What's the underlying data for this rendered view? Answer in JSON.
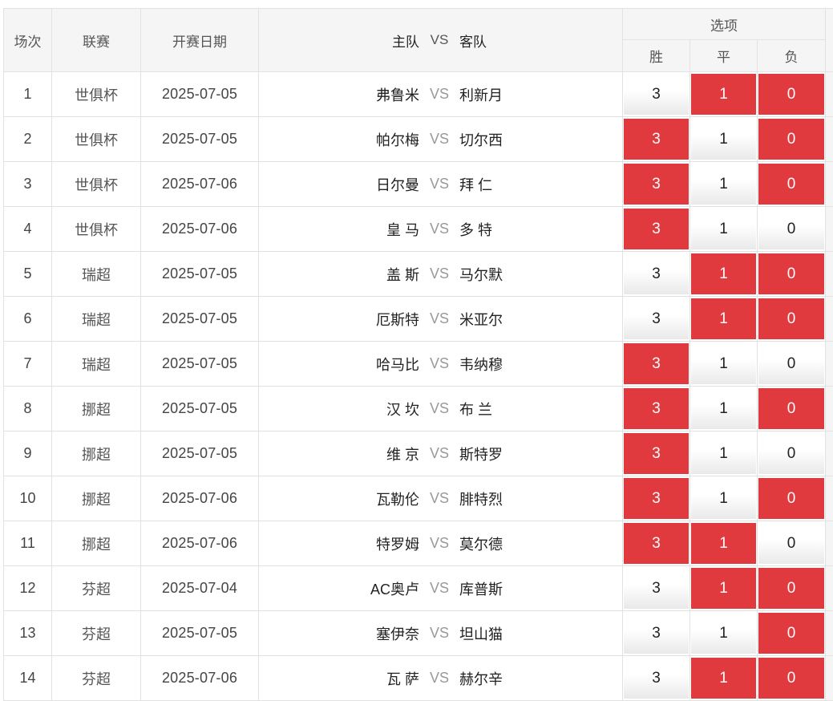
{
  "header": {
    "col_no": "场次",
    "col_league": "联赛",
    "col_date": "开赛日期",
    "col_match_home": "主队",
    "col_match_vs": "VS",
    "col_match_away": "客队",
    "col_options": "选项",
    "opt_win": "胜",
    "opt_draw": "平",
    "opt_lose": "负"
  },
  "colors": {
    "selected": "#e03a3e",
    "header_bg": "#f5f5f5"
  },
  "rows": [
    {
      "no": "1",
      "league": "世俱杯",
      "date": "2025-07-05",
      "home": "弗鲁米",
      "vs": "VS",
      "away": "利新月",
      "o3": "3",
      "o1": "1",
      "o0": "0",
      "sel": [
        false,
        true,
        true
      ]
    },
    {
      "no": "2",
      "league": "世俱杯",
      "date": "2025-07-05",
      "home": "帕尔梅",
      "vs": "VS",
      "away": "切尔西",
      "o3": "3",
      "o1": "1",
      "o0": "0",
      "sel": [
        true,
        false,
        true
      ]
    },
    {
      "no": "3",
      "league": "世俱杯",
      "date": "2025-07-06",
      "home": "日尔曼",
      "vs": "VS",
      "away": "拜 仁",
      "o3": "3",
      "o1": "1",
      "o0": "0",
      "sel": [
        true,
        false,
        true
      ]
    },
    {
      "no": "4",
      "league": "世俱杯",
      "date": "2025-07-06",
      "home": "皇 马",
      "vs": "VS",
      "away": "多 特",
      "o3": "3",
      "o1": "1",
      "o0": "0",
      "sel": [
        true,
        false,
        false
      ]
    },
    {
      "no": "5",
      "league": "瑞超",
      "date": "2025-07-05",
      "home": "盖 斯",
      "vs": "VS",
      "away": "马尔默",
      "o3": "3",
      "o1": "1",
      "o0": "0",
      "sel": [
        false,
        true,
        true
      ]
    },
    {
      "no": "6",
      "league": "瑞超",
      "date": "2025-07-05",
      "home": "厄斯特",
      "vs": "VS",
      "away": "米亚尔",
      "o3": "3",
      "o1": "1",
      "o0": "0",
      "sel": [
        false,
        true,
        true
      ]
    },
    {
      "no": "7",
      "league": "瑞超",
      "date": "2025-07-05",
      "home": "哈马比",
      "vs": "VS",
      "away": "韦纳穆",
      "o3": "3",
      "o1": "1",
      "o0": "0",
      "sel": [
        true,
        false,
        false
      ]
    },
    {
      "no": "8",
      "league": "挪超",
      "date": "2025-07-05",
      "home": "汉 坎",
      "vs": "VS",
      "away": "布 兰",
      "o3": "3",
      "o1": "1",
      "o0": "0",
      "sel": [
        true,
        false,
        true
      ]
    },
    {
      "no": "9",
      "league": "挪超",
      "date": "2025-07-05",
      "home": "维 京",
      "vs": "VS",
      "away": "斯特罗",
      "o3": "3",
      "o1": "1",
      "o0": "0",
      "sel": [
        true,
        false,
        false
      ]
    },
    {
      "no": "10",
      "league": "挪超",
      "date": "2025-07-06",
      "home": "瓦勒伦",
      "vs": "VS",
      "away": "腓特烈",
      "o3": "3",
      "o1": "1",
      "o0": "0",
      "sel": [
        true,
        false,
        true
      ]
    },
    {
      "no": "11",
      "league": "挪超",
      "date": "2025-07-06",
      "home": "特罗姆",
      "vs": "VS",
      "away": "莫尔德",
      "o3": "3",
      "o1": "1",
      "o0": "0",
      "sel": [
        true,
        true,
        false
      ]
    },
    {
      "no": "12",
      "league": "芬超",
      "date": "2025-07-04",
      "home": "AC奥卢",
      "vs": "VS",
      "away": "库普斯",
      "o3": "3",
      "o1": "1",
      "o0": "0",
      "sel": [
        false,
        true,
        true
      ]
    },
    {
      "no": "13",
      "league": "芬超",
      "date": "2025-07-05",
      "home": "塞伊奈",
      "vs": "VS",
      "away": "坦山猫",
      "o3": "3",
      "o1": "1",
      "o0": "0",
      "sel": [
        false,
        false,
        true
      ]
    },
    {
      "no": "14",
      "league": "芬超",
      "date": "2025-07-06",
      "home": "瓦 萨",
      "vs": "VS",
      "away": "赫尔辛",
      "o3": "3",
      "o1": "1",
      "o0": "0",
      "sel": [
        false,
        true,
        true
      ]
    }
  ]
}
